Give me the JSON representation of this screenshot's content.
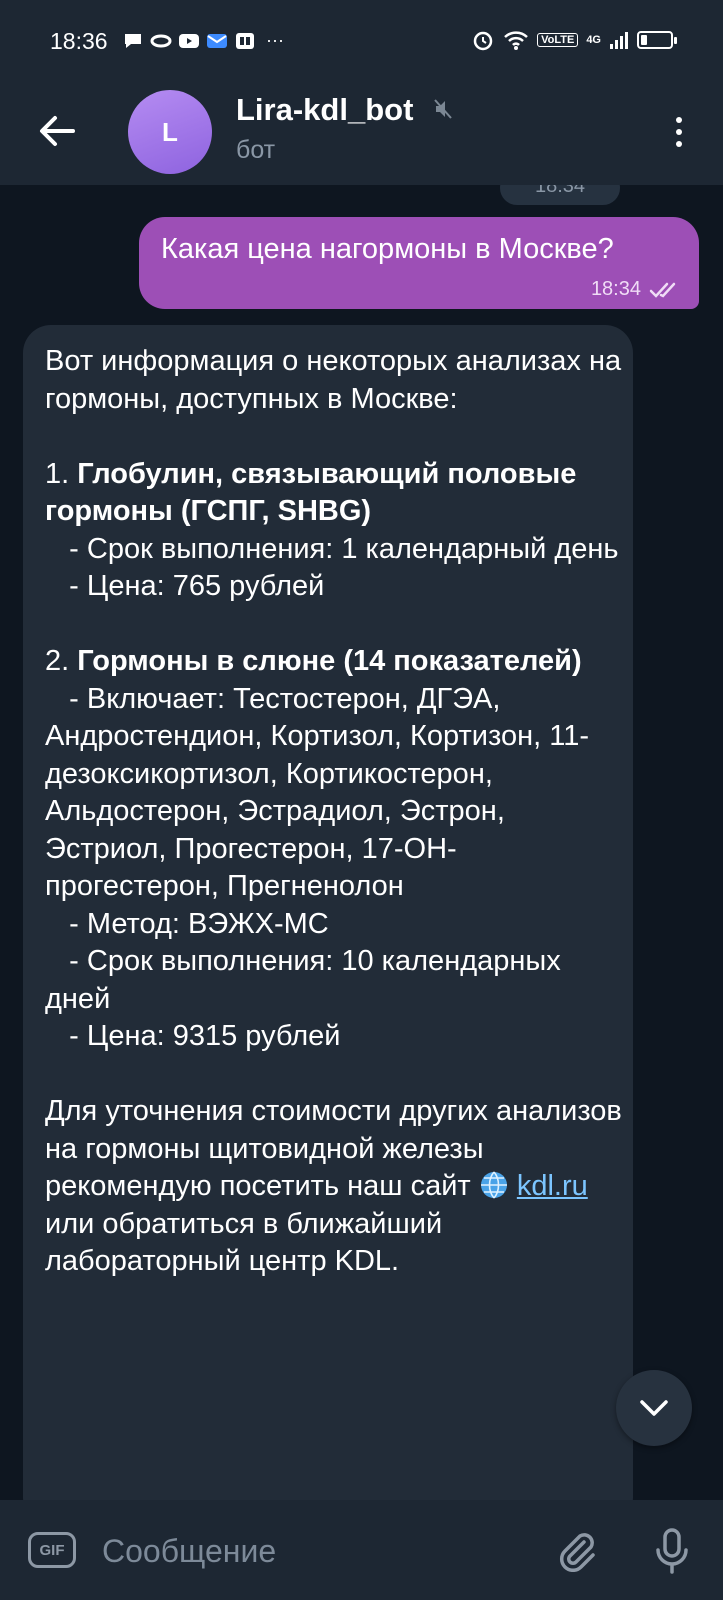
{
  "status_bar": {
    "time": "18:36",
    "more": "···",
    "volte": "VoLTE",
    "network": "4G"
  },
  "header": {
    "avatar_letter": "L",
    "title": "Lira-kdl_bot",
    "subtitle": "бот"
  },
  "chat": {
    "date_pill": "18:34",
    "outgoing": {
      "text": "Какая цена нагормоны в Москве?",
      "time": "18:34"
    },
    "incoming": {
      "intro": "Вот информация о некоторых анализах на гормоны, доступных в Москве:",
      "item1_num": "1. ",
      "item1_title": "Глобулин, связывающий половые гормоны (ГСПГ, SHBG)",
      "item1_details": "   - Срок выполнения: 1 календарный день\n   - Цена: 765 рублей",
      "item2_num": "2. ",
      "item2_title": "Гормоны в слюне (14 показателей)",
      "item2_details": "   - Включает: Тестостерон, ДГЭА, Андростендион, Кортизол, Кортизон, 11-дезоксикортизол, Кортикостерон, Альдостерон, Эстрадиол, Эстрон, Эстриол, Прогестерон, 17-ОН-прогестерон, Прегненолон\n   - Метод: ВЭЖХ-МС\n   - Срок выполнения: 10 календарных дней\n   - Цена: 9315 рублей",
      "outro_before_link": "Для уточнения стоимости других анализов на гормоны щитовидной железы рекомендую посетить наш сайт ",
      "link_text": "kdl.ru",
      "outro_after_link": " или обратиться в ближайший лабораторный центр KDL."
    }
  },
  "input": {
    "gif_label": "GIF",
    "placeholder": "Сообщение"
  },
  "colors": {
    "header_bg": "#1d2733",
    "outgoing_bubble": "#9d4fb6",
    "incoming_bubble": "#222c38",
    "link": "#7cc5ff"
  },
  "icons": [
    "back-arrow-icon",
    "mute-icon",
    "more-vert-icon",
    "double-check-icon",
    "globe-icon",
    "chevron-down-icon",
    "attach-icon",
    "mic-icon"
  ]
}
